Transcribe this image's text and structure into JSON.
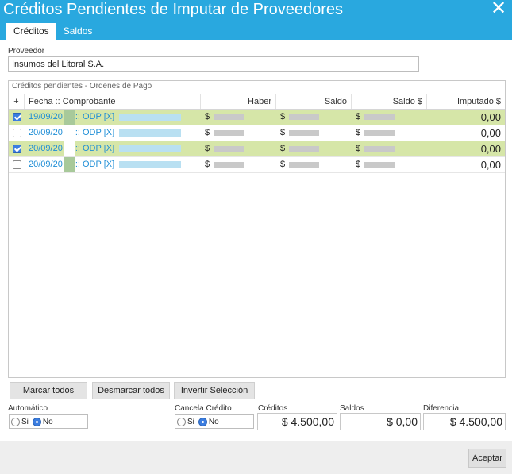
{
  "window": {
    "title": "Créditos Pendientes de Imputar de Proveedores",
    "brand_color": "#29a8df"
  },
  "tabs": [
    {
      "label": "Créditos",
      "active": true
    },
    {
      "label": "Saldos",
      "active": false
    }
  ],
  "proveedor": {
    "label": "Proveedor",
    "value": "Insumos del Litoral S.A."
  },
  "grid": {
    "caption": "Créditos pendientes - Ordenes de Pago",
    "columns": [
      "+",
      "Fecha :: Comprobante",
      "Haber",
      "Saldo",
      "Saldo $",
      "Imputado $"
    ],
    "rows": [
      {
        "checked": true,
        "selected": true,
        "date": "19/09/20",
        "comp": ":: ODP [X]",
        "cur1": "$",
        "cur2": "$",
        "cur3": "$",
        "imputado": "0,00"
      },
      {
        "checked": false,
        "selected": false,
        "date": "20/09/20",
        "comp": ":: ODP [X]",
        "cur1": "$",
        "cur2": "$",
        "cur3": "$",
        "imputado": "0,00"
      },
      {
        "checked": true,
        "selected": true,
        "date": "20/09/20",
        "comp": ":: ODP [X]",
        "cur1": "$",
        "cur2": "$",
        "cur3": "$",
        "imputado": "0,00"
      },
      {
        "checked": false,
        "selected": false,
        "date": "20/09/20",
        "comp": ":: ODP [X]",
        "cur1": "$",
        "cur2": "$",
        "cur3": "$",
        "imputado": "0,00"
      }
    ]
  },
  "buttons": {
    "marcar": "Marcar todos",
    "desmarcar": "Desmarcar todos",
    "invertir": "Invertir Selección",
    "aceptar": "Aceptar"
  },
  "automatico": {
    "label": "Automático",
    "si": "Si",
    "no": "No",
    "selected": "No"
  },
  "cancela": {
    "label": "Cancela Crédito",
    "si": "Si",
    "no": "No",
    "selected": "No"
  },
  "totals": {
    "creditos_label": "Créditos",
    "creditos": "$ 4.500,00",
    "saldos_label": "Saldos",
    "saldos": "$ 0,00",
    "diferencia_label": "Diferencia",
    "diferencia": "$ 4.500,00"
  }
}
